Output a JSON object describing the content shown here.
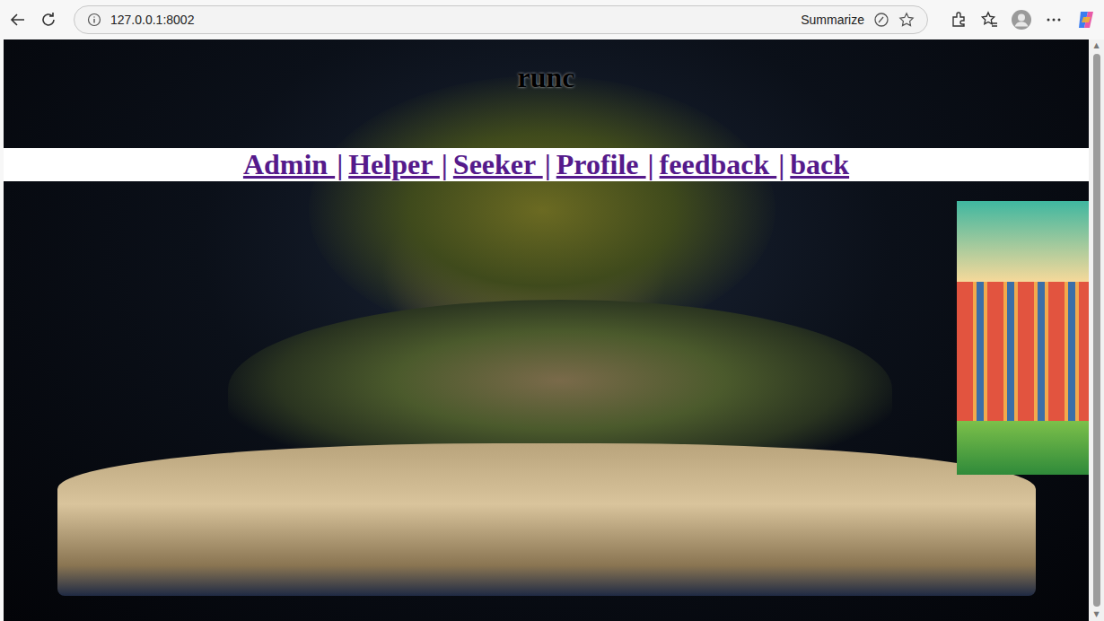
{
  "browser": {
    "url": "127.0.0.1:8002",
    "summarize": "Summarize"
  },
  "page": {
    "heading": "runc",
    "separator": "|",
    "nav": [
      {
        "label": "Admin ",
        "visited": true
      },
      {
        "label": "Helper ",
        "visited": true
      },
      {
        "label": "Seeker ",
        "visited": true
      },
      {
        "label": "Profile ",
        "visited": true
      },
      {
        "label": "feedback ",
        "visited": true
      },
      {
        "label": "back",
        "visited": true
      }
    ]
  }
}
